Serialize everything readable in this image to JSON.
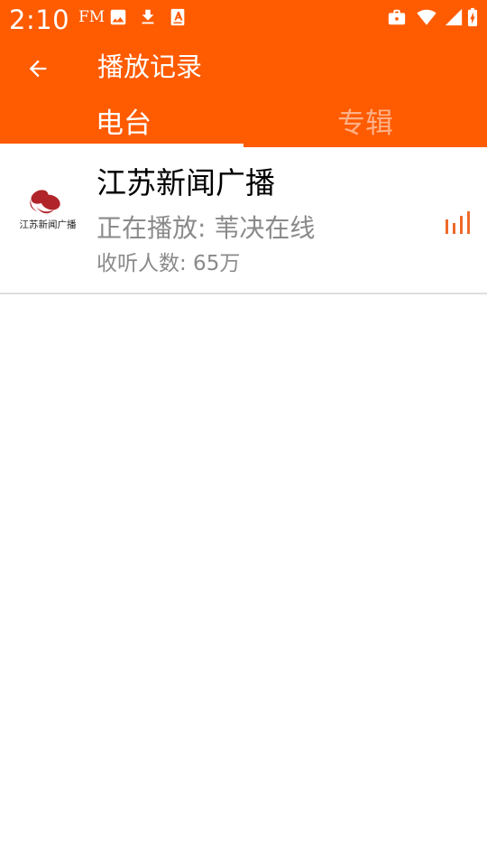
{
  "status_bar": {
    "time": "2:10",
    "fm_label": "FM",
    "icons": [
      "image-icon",
      "download-icon",
      "text-a-icon",
      "briefcase-icon",
      "wifi-icon",
      "signal-icon",
      "battery-charging-icon"
    ]
  },
  "app_bar": {
    "title": "播放记录",
    "back_icon": "arrow-left-icon"
  },
  "tabs": [
    {
      "label": "电台",
      "selected": true
    },
    {
      "label": "专辑",
      "selected": false
    }
  ],
  "history": [
    {
      "station_name": "江苏新闻广播",
      "now_playing": "正在播放: 苇决在线",
      "listeners": "收听人数: 65万",
      "logo_icon": "jiangsu-news-radio-logo",
      "logo_caption": "江苏新闻广播",
      "indicator_icon": "audio-bars-icon"
    }
  ],
  "colors": {
    "primary": "#ff5b00",
    "tab_inactive": "#ffb088",
    "secondary_text": "#8a8a8a",
    "indicator": "#ee6a2a",
    "logo_red": "#b0242a",
    "divider": "#dedede"
  }
}
